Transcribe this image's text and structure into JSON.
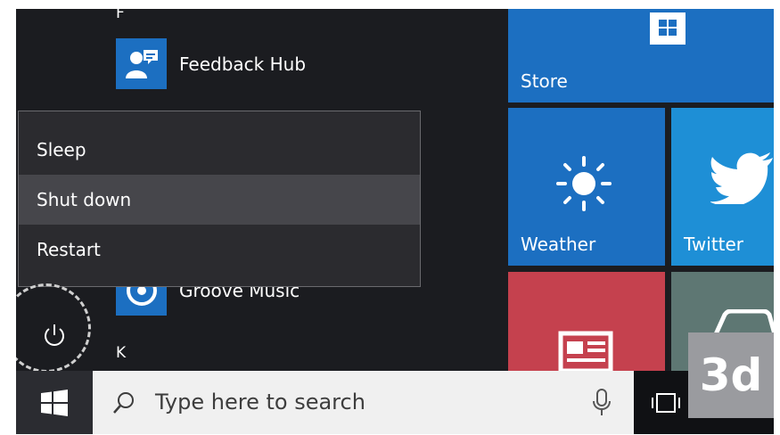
{
  "app_list": {
    "letter_f": "F",
    "feedback_hub": "Feedback Hub",
    "groove_music": "Groove Music",
    "letter_k": "K"
  },
  "power_menu": {
    "items": [
      {
        "label": "Sleep",
        "highlighted": false
      },
      {
        "label": "Shut down",
        "highlighted": true
      },
      {
        "label": "Restart",
        "highlighted": false
      }
    ]
  },
  "tiles": {
    "store": {
      "label": "Store",
      "color": "#1c6fc1"
    },
    "weather": {
      "label": "Weather",
      "color": "#1c6fc1"
    },
    "twitter": {
      "label": "Twitter",
      "color": "#1e8fd6"
    },
    "news": {
      "label": "",
      "color": "#c5414e"
    },
    "unknown": {
      "label": "",
      "color": "#5e7773"
    }
  },
  "taskbar": {
    "search_placeholder": "Type here to search",
    "icons": [
      "windows-logo-icon",
      "search-icon",
      "microphone-icon",
      "task-view-icon"
    ]
  },
  "step_badge": "3d",
  "colors": {
    "start_bg": "#1b1c20",
    "accent_blue": "#1c6fc1",
    "menu_bg": "#2b2b2f",
    "menu_hover": "#46464b",
    "taskbar_bg": "#101114",
    "search_bg": "#f0f0f0"
  }
}
